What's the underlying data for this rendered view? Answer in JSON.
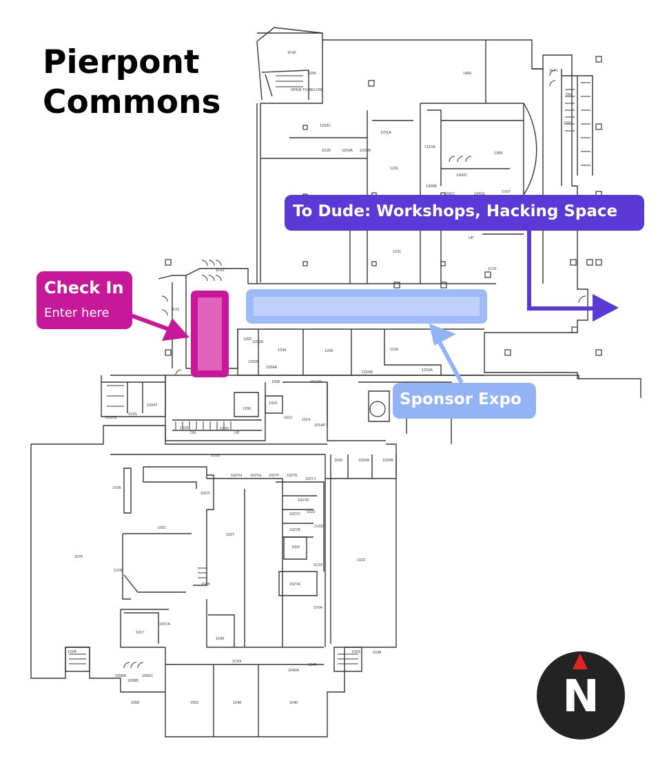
{
  "title": {
    "line1": "Pierpont",
    "line2": "Commons"
  },
  "callouts": {
    "checkin": {
      "heading": "Check In",
      "sub": "Enter here",
      "color": "#c8189a"
    },
    "dude": {
      "label": "To Dude: Workshops, Hacking Space",
      "color": "#5a3ad6"
    },
    "expo": {
      "label": "Sponsor Expo",
      "color": "#93b3f7"
    }
  },
  "compass": {
    "letter": "N",
    "pointer_color": "#e32424"
  },
  "rooms": {
    "r1f42": "1F42",
    "r1s05": "1S05",
    "r_open": "OPEN TO BELOW",
    "r1400": "1400",
    "r1f41": "1F41",
    "r1s07": "1S07",
    "rdn1": "DN",
    "r1203c": "1203C",
    "r1231a": "1231A",
    "r1310a": "1310A",
    "r1309": "1309",
    "r1c20": "1C20",
    "r1203a": "1203A",
    "r1203b": "1203B",
    "r1231": "1231",
    "r1300c": "1300C",
    "r1300b": "1300B",
    "r1241c": "1241C",
    "r1241e": "1241E",
    "r1v07": "1V07",
    "r1221": "1221",
    "r1c01": "1C01",
    "rup1": "UP",
    "r1f22": "1F22",
    "r1f21": "1F21",
    "r1202": "1202",
    "r1202a": "1202A",
    "r1202b": "1202B",
    "r1204": "1204",
    "r1204a": "1204A",
    "r1208": "1208",
    "r1216": "1216",
    "r1216b": "1216B",
    "r1216a": "1216A",
    "r1008": "1008",
    "r1012m": "1012M",
    "r1s01": "1S01",
    "r1200": "1200",
    "r1012": "1012",
    "r1014": "1014",
    "r101ap": "101AP",
    "r1v01": "1V01",
    "r1002w": "1002W",
    "r1004t": "1004T",
    "r1s02": "1S02",
    "r1s03": "1S03",
    "rdn2": "DN",
    "rup2": "UP",
    "r1c02": "1C02",
    "r1020": "1020",
    "r1020a": "1020A",
    "r1020b": "1020B",
    "r1027h": "1027H",
    "r1027g": "1027G",
    "r1027f": "1027F",
    "r1027e": "1027E",
    "r1027j": "1027J",
    "r1027i": "1027I",
    "r1027d": "1027D",
    "r1027c": "1027C",
    "r1027b": "1027B",
    "r1023": "1023",
    "r1v03": "1V03",
    "r1032": "1032",
    "r1v06": "1V06",
    "r1051": "1051",
    "r1027": "1027",
    "r1076": "1076",
    "r1022": "1022",
    "r1c03": "1C03",
    "r1v05": "1V05",
    "r1s05b": "1S05",
    "r1027a": "1027A",
    "r1v04": "1V04",
    "r1057a": "1057A",
    "r1017": "1017",
    "r1049": "1049",
    "r1s04": "1S04",
    "r1c04": "1C04",
    "r1040a": "1040A",
    "r1042": "1042",
    "r1s03b": "1S03",
    "r1038": "1038",
    "r1058a": "1058A",
    "r1056c": "1056C",
    "r1058b": "1058B",
    "r1058": "1058",
    "r1052": "1052",
    "r1048": "1048",
    "r1040": "1040"
  }
}
